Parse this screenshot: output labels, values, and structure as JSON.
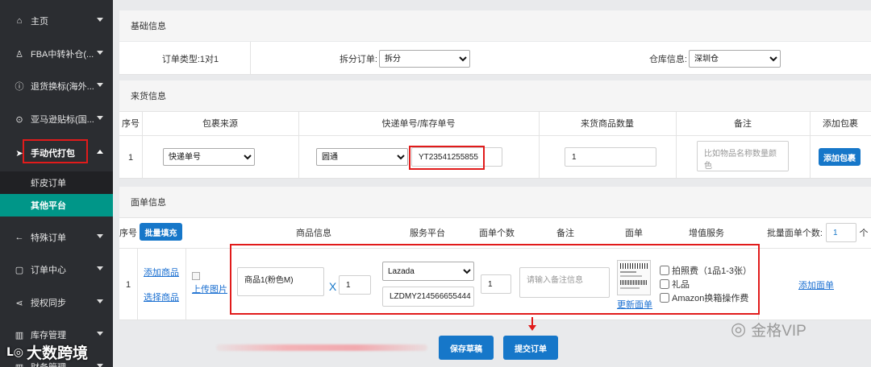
{
  "sidebar": {
    "items": [
      {
        "icon": "home-icon",
        "glyph": "⌂",
        "label": "主页"
      },
      {
        "icon": "gift-icon",
        "glyph": "♙",
        "label": "FBA中转补仓(..."
      },
      {
        "icon": "info-circle-icon",
        "glyph": "ⓘ",
        "label": "退货换标(海外..."
      },
      {
        "icon": "label-icon",
        "glyph": "⊙",
        "label": "亚马逊贴标(国..."
      },
      {
        "icon": "send-icon",
        "glyph": "➤",
        "label": "手动代打包"
      },
      {
        "icon": "arrow-left-icon",
        "glyph": "←",
        "label": "特殊订单"
      },
      {
        "icon": "order-icon",
        "glyph": "▢",
        "label": "订单中心"
      },
      {
        "icon": "share-icon",
        "glyph": "⋖",
        "label": "授权同步"
      },
      {
        "icon": "inventory-icon",
        "glyph": "▥",
        "label": "库存管理"
      },
      {
        "icon": "finance-icon",
        "glyph": "▥",
        "label": "财务管理"
      }
    ],
    "subitems": [
      {
        "label": "虾皮订单"
      },
      {
        "label": "其他平台"
      }
    ]
  },
  "basic": {
    "title": "基础信息",
    "order_type": "订单类型:1对1",
    "split_label": "拆分订单:",
    "split_value": "拆分",
    "warehouse_label": "仓库信息:",
    "warehouse_value": "深圳仓"
  },
  "incoming": {
    "title": "来货信息",
    "headers": [
      "序号",
      "包裹来源",
      "快递单号/库存单号",
      "来货商品数量",
      "备注",
      "添加包裹"
    ],
    "row": {
      "index": "1",
      "source": "快递单号",
      "carrier": "圆通",
      "tracking": "YT23541255855",
      "quantity": "1",
      "remark_placeholder": "比如物品名称数量颜色",
      "add_button": "添加包裹"
    }
  },
  "waybill": {
    "title": "面单信息",
    "headers": [
      "序号",
      "商品信息",
      "服务平台",
      "面单个数",
      "备注",
      "面单",
      "增值服务"
    ],
    "bulk_fill": "批量填充",
    "batch_label": "批量面单个数:",
    "batch_value": "1",
    "batch_unit": "个",
    "row": {
      "index": "1",
      "add_product": "添加商品",
      "select_product": "选择商品",
      "upload_image": "上传图片",
      "product_name": "商品1(粉色M)",
      "multiply": "X",
      "product_qty": "1",
      "platform": "Lazada",
      "platform_order": "LZDMY214566655444",
      "label_count": "1",
      "remark_placeholder": "请输入备注信息",
      "update_label": "更新面单",
      "services": [
        "拍照费（1品1-3张）",
        "礼品",
        "Amazon换箱操作费"
      ],
      "add_label": "添加面单"
    }
  },
  "actions": {
    "save_draft": "保存草稿",
    "submit": "提交订单"
  },
  "watermarks": {
    "left": "大数跨境",
    "right": "金格VIP"
  },
  "colors": {
    "primary": "#1677c9",
    "sidebar_bg": "#2b2d31",
    "active_sub": "#009688",
    "highlight": "#e11b1b"
  }
}
